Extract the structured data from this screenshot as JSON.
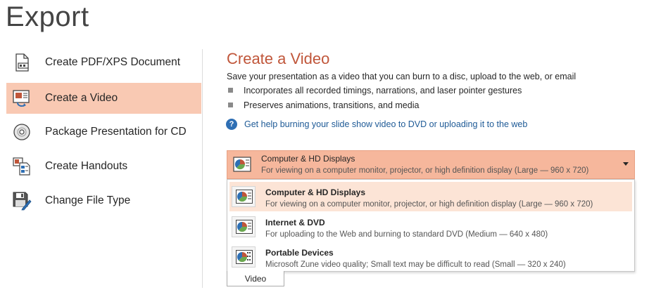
{
  "page": {
    "title": "Export"
  },
  "nav": {
    "items": [
      {
        "label": "Create PDF/XPS Document",
        "icon": "pdf-document-icon",
        "selected": false
      },
      {
        "label": "Create a Video",
        "icon": "video-icon",
        "selected": true
      },
      {
        "label": "Package Presentation for CD",
        "icon": "cd-icon",
        "selected": false
      },
      {
        "label": "Create Handouts",
        "icon": "handouts-icon",
        "selected": false
      },
      {
        "label": "Change File Type",
        "icon": "save-file-type-icon",
        "selected": false
      }
    ]
  },
  "main": {
    "title": "Create a Video",
    "description": "Save your presentation as a video that you can burn to a disc, upload to the web, or email",
    "bullets": [
      "Incorporates all recorded timings, narrations, and laser pointer gestures",
      "Preserves animations, transitions, and media"
    ],
    "help_link": "Get help burning your slide show video to DVD or uploading it to the web",
    "quality_dropdown": {
      "selected_title": "Computer & HD Displays",
      "selected_subtitle": "For viewing on a computer monitor, projector, or high definition display  (Large — 960 x 720)",
      "options": [
        {
          "title": "Computer & HD Displays",
          "subtitle": "For viewing on a computer monitor, projector, or high definition display  (Large — 960 x 720)"
        },
        {
          "title": "Internet & DVD",
          "subtitle": "For uploading to the Web and burning to standard DVD  (Medium — 640 x 480)"
        },
        {
          "title": "Portable Devices",
          "subtitle": "Microsoft Zune video quality; Small text may be difficult to read  (Small — 320 x 240)"
        }
      ]
    },
    "create_button_label": "Video"
  },
  "colors": {
    "accent": "#c0563a",
    "selected_bg": "#f9c9b3",
    "dropdown_bg": "#f6b79c",
    "hover_bg": "#fce4d6",
    "link": "#1e5a96"
  }
}
